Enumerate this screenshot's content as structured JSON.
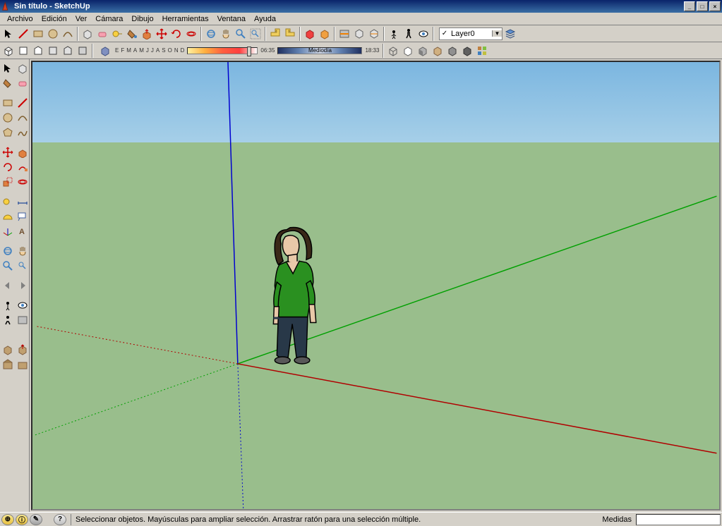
{
  "title": "Sin título - SketchUp",
  "menu": [
    "Archivo",
    "Edición",
    "Ver",
    "Cámara",
    "Dibujo",
    "Herramientas",
    "Ventana",
    "Ayuda"
  ],
  "layer": {
    "checked": "✓",
    "name": "Layer0"
  },
  "shadow_months": [
    "E",
    "F",
    "M",
    "A",
    "M",
    "J",
    "J",
    "A",
    "S",
    "O",
    "N",
    "D"
  ],
  "shadow_time_start": "06:35",
  "shadow_time_mid": "Mediodía",
  "shadow_time_end": "18:33",
  "status_hint": "Seleccionar objetos. Mayúsculas para ampliar selección. Arrastrar ratón para una selección múltiple.",
  "measure_label": "Medidas",
  "icons": {
    "select": "select",
    "paint": "paint",
    "rect": "rect",
    "circle": "circle",
    "arc": "arc",
    "make": "make",
    "erase": "erase",
    "tape": "tape",
    "dim": "dim",
    "text": "text",
    "axes": "axes",
    "push": "push",
    "move": "move",
    "rotate": "rotate",
    "follow": "follow",
    "scale": "scale",
    "offset": "offset",
    "orbit": "orbit",
    "pan": "pan",
    "zoom": "zoom",
    "zoomext": "zoomext",
    "prev": "prev",
    "next": "next",
    "iso": "iso",
    "top": "top",
    "front": "front",
    "right": "right",
    "back": "back",
    "left": "left",
    "section": "section",
    "walk": "walk",
    "look": "look",
    "shadow": "shadow",
    "lines": "lines",
    "hlr": "hlr",
    "shaded": "shaded",
    "shadtex": "shadtex",
    "xray": "xray",
    "mono": "mono",
    "3dw": "3dw",
    "line": "line",
    "poly": "poly",
    "freehand": "freehand",
    "protractor": "protractor",
    "label": "label",
    "position": "position"
  }
}
